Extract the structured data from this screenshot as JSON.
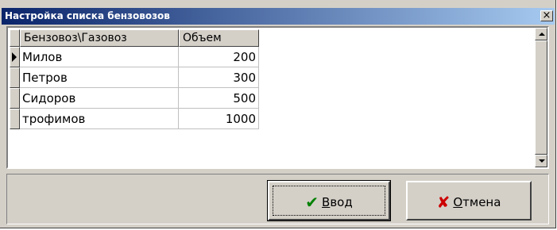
{
  "window": {
    "title": "Настройка списка бензовозов",
    "close_label": "×"
  },
  "grid": {
    "columns": [
      "Бензовоз\\Газовоз",
      "Объем"
    ],
    "rows": [
      {
        "name": "Милов",
        "volume": "200",
        "current": true
      },
      {
        "name": "Петров",
        "volume": "300",
        "current": false
      },
      {
        "name": "Сидоров",
        "volume": "500",
        "current": false
      },
      {
        "name": "трофимов",
        "volume": "1000",
        "current": false
      }
    ]
  },
  "buttons": {
    "ok": {
      "icon": "checkmark-icon",
      "mnemonic": "В",
      "rest": "вод",
      "color": "#008000"
    },
    "cancel": {
      "icon": "x-icon",
      "mnemonic": "О",
      "rest": "тмена",
      "color": "#cc0000"
    }
  }
}
